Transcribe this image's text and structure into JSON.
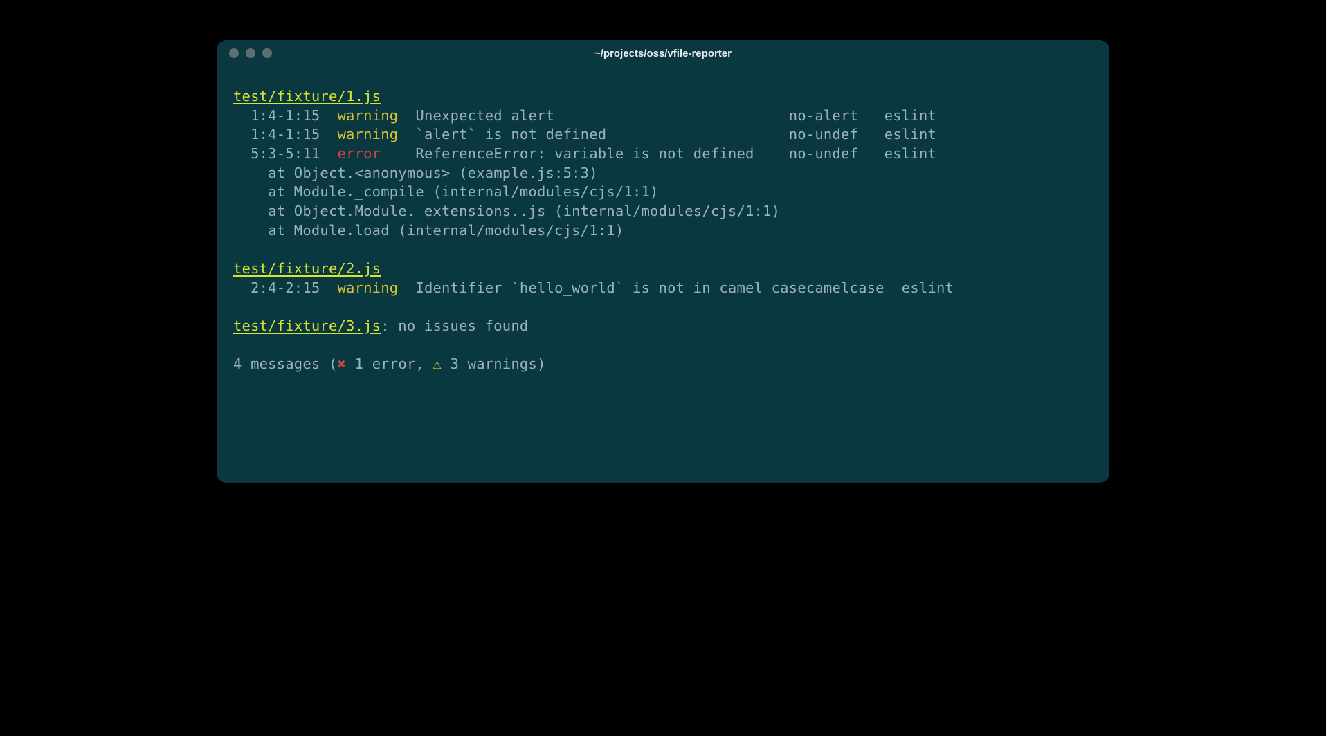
{
  "window": {
    "title": "~/projects/oss/vfile-reporter"
  },
  "files": [
    {
      "path": "test/fixture/1.js",
      "noIssues": false,
      "messages": [
        {
          "location": "1:4-1:15",
          "severity": "warning",
          "reason": "Unexpected alert",
          "ruleId": "no-alert",
          "source": "eslint"
        },
        {
          "location": "1:4-1:15",
          "severity": "warning",
          "reason": "`alert` is not defined",
          "ruleId": "no-undef",
          "source": "eslint"
        },
        {
          "location": "5:3-5:11",
          "severity": "error",
          "reason": "ReferenceError: variable is not defined",
          "ruleId": "no-undef",
          "source": "eslint",
          "stack": [
            "at Object.<anonymous> (example.js:5:3)",
            "at Module._compile (internal/modules/cjs/1:1)",
            "at Object.Module._extensions..js (internal/modules/cjs/1:1)",
            "at Module.load (internal/modules/cjs/1:1)"
          ]
        }
      ]
    },
    {
      "path": "test/fixture/2.js",
      "noIssues": false,
      "messages": [
        {
          "location": "2:4-2:15",
          "severity": "warning",
          "reason": "Identifier `hello_world` is not in camel case",
          "ruleId": "camelcase",
          "source": "eslint"
        }
      ]
    },
    {
      "path": "test/fixture/3.js",
      "noIssues": true,
      "noIssuesText": "no issues found"
    }
  ],
  "summary": {
    "prefix": "4 messages (",
    "errorMark": "✖",
    "errorText": " 1 error, ",
    "warningMark": "⚠",
    "warningText": " 3 warnings)",
    "totalMessages": 4,
    "errors": 1,
    "warnings": 3
  },
  "columnWidths": {
    "indent": 2,
    "location": 10,
    "severity": 9,
    "reason": 43,
    "ruleId": 11
  },
  "stackIndent": 4
}
